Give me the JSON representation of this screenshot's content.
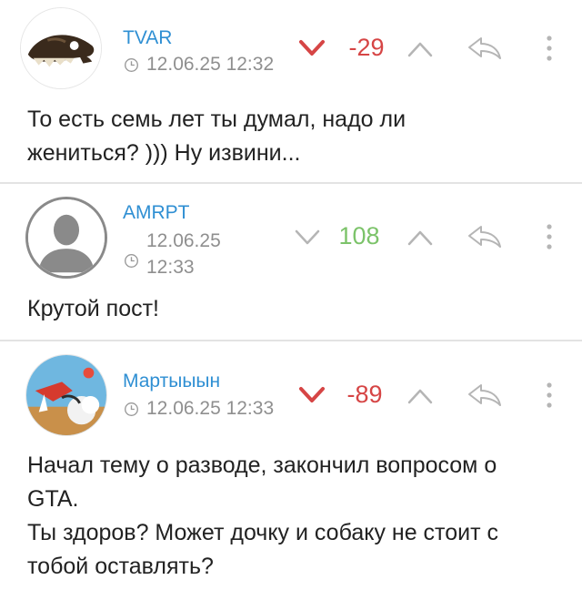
{
  "comments": [
    {
      "author": "TVAR",
      "date": "12.06.25 12:32",
      "rating": "-29",
      "text": "То есть семь лет ты думал, надо ли\nжениться? ))) Ну извини..."
    },
    {
      "author": "AMRPT",
      "date_line1": "12.06.25",
      "date_line2": "12:33",
      "rating": "108",
      "text": "Крутой пост!"
    },
    {
      "author": "Мартыыын",
      "date": "12.06.25 12:33",
      "rating": "-89",
      "text": "Начал тему о разводе, закончил вопросом о\nGTA.\nТы здоров? Может дочку и собаку не стоит с\nтобой оставлять?"
    }
  ],
  "colors": {
    "username": "#2f8fd3",
    "negative": "#d64545",
    "positive": "#7cc36a",
    "icon_gray": "#b5b5b5",
    "meta_text": "#8f8f8f"
  },
  "icons": [
    "clock-icon",
    "downvote-icon",
    "upvote-icon",
    "reply-icon",
    "more-icon"
  ]
}
